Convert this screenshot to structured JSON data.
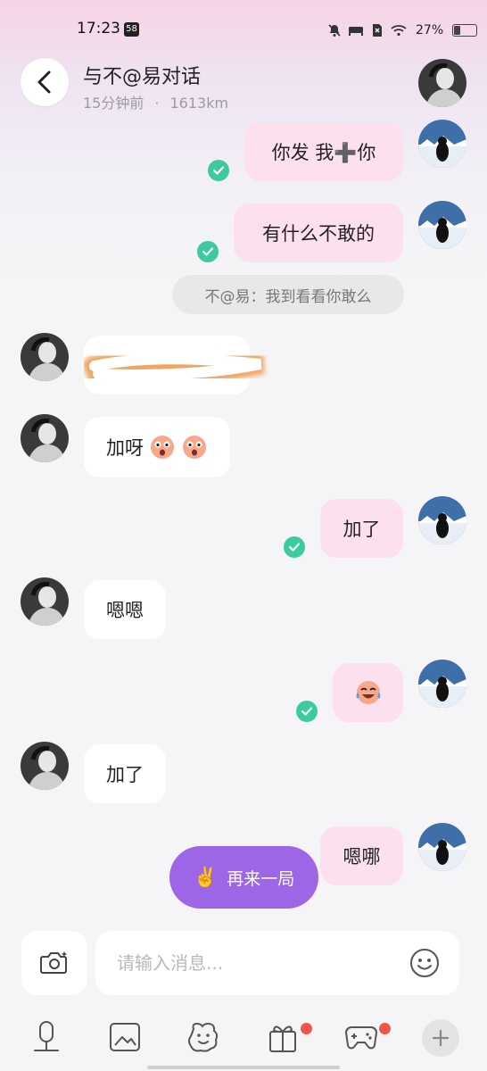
{
  "status_bar": {
    "time": "17:23",
    "badge": "58",
    "battery": "27%",
    "battery_level": 0.27
  },
  "header": {
    "title": "与不@易对话",
    "last_seen": "15分钟前",
    "separator": "·",
    "distance": "1613km"
  },
  "messages": {
    "m1": "你发 我➕你",
    "m2": "有什么不敢的",
    "system_note": "不@易：我到看看你敢么",
    "m4": "加呀",
    "m5": "加了",
    "m6": "嗯嗯",
    "m8": "加了",
    "m9": "嗯哪"
  },
  "play_again": {
    "emoji": "✌️",
    "label": "再来一局"
  },
  "input": {
    "placeholder": "请输入消息..."
  },
  "colors": {
    "outgoing_bubble": "#fde0ee",
    "incoming_bubble": "#ffffff",
    "read_check": "#3dcaa0",
    "play_again": "#9d66e6",
    "notification_dot": "#f0554b"
  }
}
